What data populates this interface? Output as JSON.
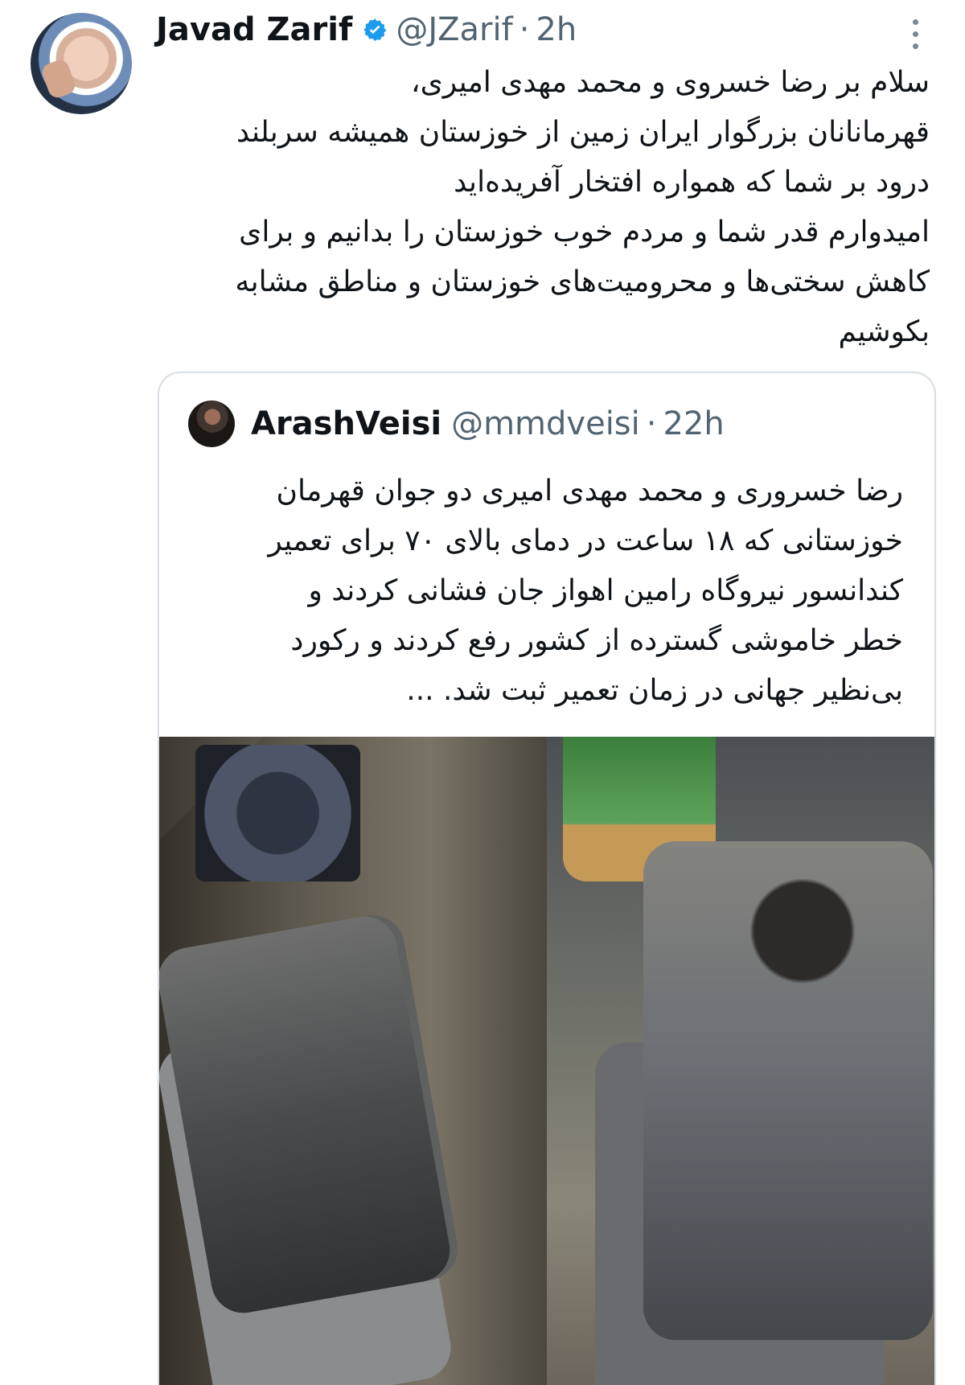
{
  "tweet": {
    "author_name": "Javad Zarif",
    "author_handle": "@JZarif",
    "separator": "·",
    "time": "2h",
    "lines": [
      "سلام بر رضا خسروی و محمد مهدی امیری،",
      "قهرمانانان بزرگوار ایران زمین از خوزستان همیشه سربلند",
      "درود بر شما که همواره افتخار آفریده‌اید",
      "امیدوارم قدر شما و مردم خوب خوزستان را بدانیم و برای",
      "کاهش سختی‌ها و محرومیت‌های خوزستان و مناطق مشابه",
      "بکوشیم"
    ]
  },
  "quoted_tweet": {
    "author_name": "ArashVeisi",
    "author_handle": "@mmdveisi",
    "separator": "·",
    "time": "22h",
    "lines": [
      "رضا خسروری و محمد مهدی امیری دو جوان قهرمان",
      "خوزستانی که ۱۸ ساعت در دمای بالای ۷۰ برای تعمیر",
      "کندانسور نیروگاه رامین اهواز جان فشانی کردند و",
      "خطر خاموشی گسترده از کشور رفع کردند و رکورد",
      "بی‌نظیر جهانی در زمان تعمیر ثبت شد. ..."
    ]
  },
  "icons": {
    "verified": "verified-badge-icon",
    "more": "more-options-icon"
  },
  "colors": {
    "text": "#0f1419",
    "muted": "#536471",
    "verified": "#1d9bf0",
    "border": "#d7dee4"
  }
}
